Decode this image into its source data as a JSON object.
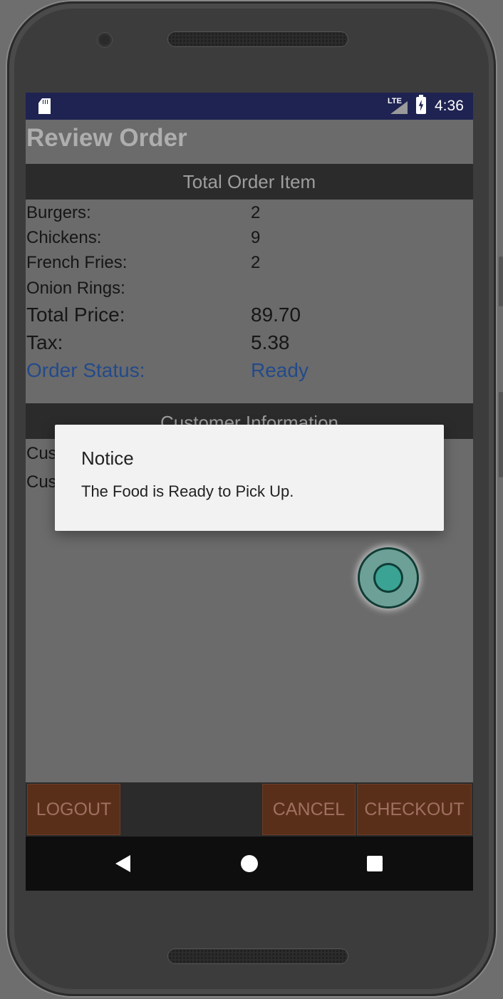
{
  "statusbar": {
    "network": "LTE",
    "time": "4:36"
  },
  "app": {
    "title": "Review Order",
    "order_section_header": "Total Order Item",
    "order_items": [
      {
        "label": "Burgers:",
        "value": "2"
      },
      {
        "label": "Chickens:",
        "value": "9"
      },
      {
        "label": "French Fries:",
        "value": "2"
      },
      {
        "label": "Onion Rings:",
        "value": ""
      }
    ],
    "totals": {
      "price_label": "Total Price:",
      "price_value": "89.70",
      "tax_label": "Tax:",
      "tax_value": "5.38",
      "status_label": "Order Status:",
      "status_value": "Ready"
    },
    "customer_section_header": "Customer Information",
    "customer_rows": [
      "Cus",
      "Cus"
    ],
    "buttons": {
      "logout": "LOGOUT",
      "cancel": "CANCEL",
      "checkout": "CHECKOUT"
    }
  },
  "dialog": {
    "title": "Notice",
    "message": "The Food is Ready to Pick Up."
  },
  "icons": {
    "sd_card": "sd-card-icon",
    "signal": "signal-icon",
    "battery": "battery-charging-icon",
    "nav_back": "back-icon",
    "nav_home": "home-icon",
    "nav_recent": "recent-apps-icon"
  },
  "colors": {
    "statusbar": "#1e2352",
    "button_bg": "#5a2f1a",
    "status_text": "#234a8a",
    "dialog_bg": "#f2f2f2"
  }
}
